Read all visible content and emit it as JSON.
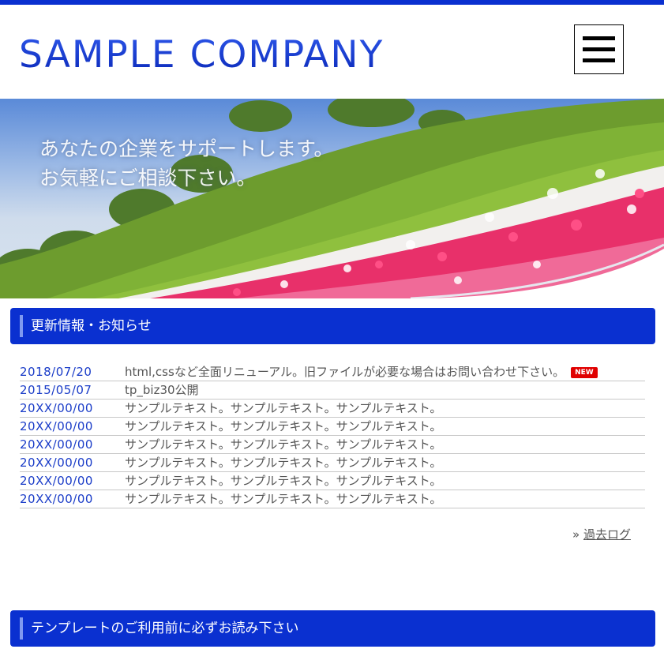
{
  "header": {
    "logo": "SAMPLE COMPANY",
    "menu_icon": "hamburger-menu-icon"
  },
  "hero": {
    "line1": "あなたの企業をサポートします。",
    "line2": "お気軽にご相談下さい。"
  },
  "news": {
    "title": "更新情報・お知らせ",
    "new_badge": "NEW",
    "items": [
      {
        "date": "2018/07/20",
        "text": "html,cssなど全面リニューアル。旧ファイルが必要な場合はお問い合わせ下さい。"
      },
      {
        "date": "2015/05/07",
        "text": "tp_biz30公開"
      },
      {
        "date": "20XX/00/00",
        "text": "サンプルテキスト。サンプルテキスト。サンプルテキスト。"
      },
      {
        "date": "20XX/00/00",
        "text": "サンプルテキスト。サンプルテキスト。サンプルテキスト。"
      },
      {
        "date": "20XX/00/00",
        "text": "サンプルテキスト。サンプルテキスト。サンプルテキスト。"
      },
      {
        "date": "20XX/00/00",
        "text": "サンプルテキスト。サンプルテキスト。サンプルテキスト。"
      },
      {
        "date": "20XX/00/00",
        "text": "サンプルテキスト。サンプルテキスト。サンプルテキスト。"
      },
      {
        "date": "20XX/00/00",
        "text": "サンプルテキスト。サンプルテキスト。サンプルテキスト。"
      }
    ],
    "past_log_prefix": "»",
    "past_log_label": "過去ログ"
  },
  "notice": {
    "title": "テンプレートのご利用前に必ずお読み下さい"
  },
  "colors": {
    "brand_blue": "#0a30d0",
    "date_blue": "#1a3cc8",
    "badge_red": "#e00000"
  }
}
